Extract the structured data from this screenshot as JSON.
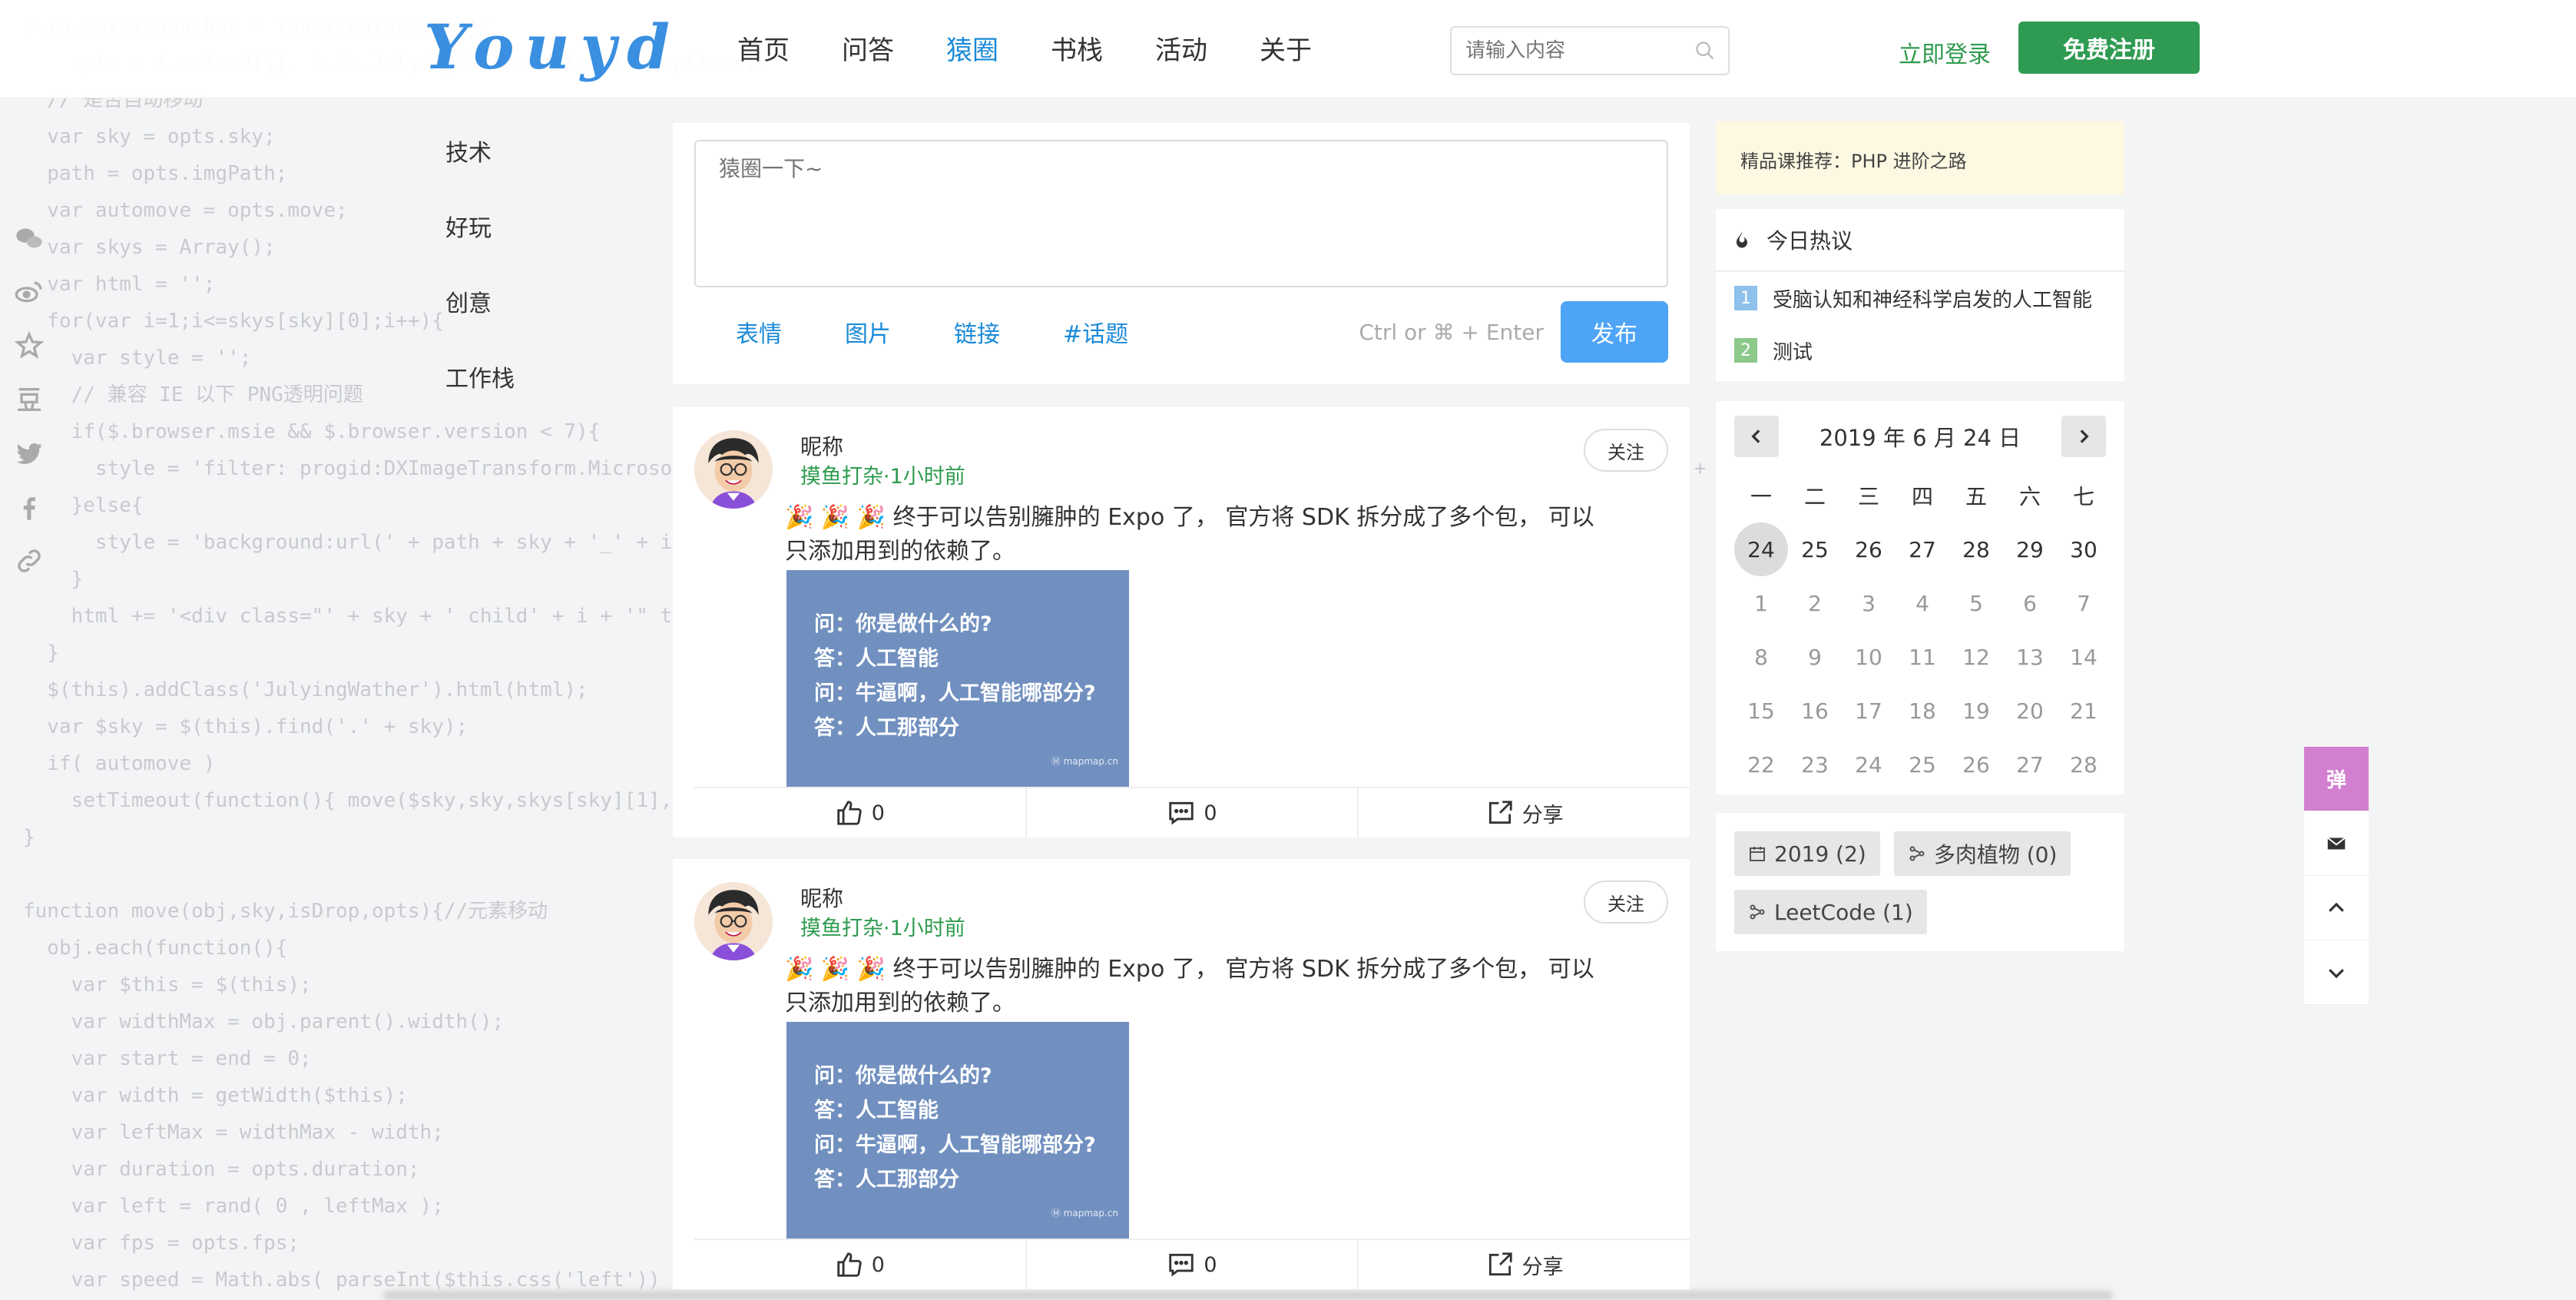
{
  "site": {
    "logo": "Youyd"
  },
  "nav": {
    "items": [
      "首页",
      "问答",
      "猿圈",
      "书栈",
      "活动",
      "关于"
    ],
    "active_index": 2
  },
  "search": {
    "placeholder": "请输入内容"
  },
  "auth": {
    "login": "立即登录",
    "register": "免费注册"
  },
  "categories": [
    "技术",
    "好玩",
    "创意",
    "工作栈"
  ],
  "social_icons": [
    "wechat-icon",
    "weibo-icon",
    "star-icon",
    "douban-icon",
    "twitter-icon",
    "facebook-icon",
    "link-icon"
  ],
  "composer": {
    "placeholder": "猿圈一下~",
    "tools": [
      "表情",
      "图片",
      "链接",
      "#话题"
    ],
    "hint": "Ctrl or ⌘ + Enter",
    "publish": "发布"
  },
  "posts": [
    {
      "name": "昵称",
      "meta": "摸鱼打杂·1小时前",
      "follow": "关注",
      "text": "🎉 🎉 🎉  终于可以告别臃肿的 Expo 了， 官方将 SDK 拆分成了多个包， 可以只添加用到的依赖了。",
      "image_lines": [
        "问：你是做什么的?",
        "答：人工智能",
        "问：牛逼啊，人工智能哪部分?",
        "答：人工那部分"
      ],
      "image_mark": "Ⓜ mapmap.cn",
      "likes": "0",
      "comments": "0",
      "share": "分享"
    },
    {
      "name": "昵称",
      "meta": "摸鱼打杂·1小时前",
      "follow": "关注",
      "text": "🎉 🎉 🎉  终于可以告别臃肿的 Expo 了， 官方将 SDK 拆分成了多个包， 可以只添加用到的依赖了。",
      "image_lines": [
        "问：你是做什么的?",
        "答：人工智能",
        "问：牛逼啊，人工智能哪部分?",
        "答：人工那部分"
      ],
      "image_mark": "Ⓜ mapmap.cn",
      "likes": "0",
      "comments": "0",
      "share": "分享"
    }
  ],
  "promo": "精品课推荐：PHP 进阶之路",
  "hot": {
    "title": "今日热议",
    "items": [
      {
        "num": "1",
        "text": "受脑认知和神经科学启发的人工智能",
        "color": "#8ec1ec"
      },
      {
        "num": "2",
        "text": "测试",
        "color": "#8cc98a"
      }
    ]
  },
  "calendar": {
    "title": "2019 年  6 月  24 日",
    "weekdays": [
      "一",
      "二",
      "三",
      "四",
      "五",
      "六",
      "七"
    ],
    "rows": [
      [
        "24",
        "25",
        "26",
        "27",
        "28",
        "29",
        "30"
      ],
      [
        "1",
        "2",
        "3",
        "4",
        "5",
        "6",
        "7"
      ],
      [
        "8",
        "9",
        "10",
        "11",
        "12",
        "13",
        "14"
      ],
      [
        "15",
        "16",
        "17",
        "18",
        "19",
        "20",
        "21"
      ],
      [
        "22",
        "23",
        "24",
        "25",
        "26",
        "27",
        "28"
      ]
    ],
    "today": "24"
  },
  "tags": [
    {
      "label": "2019 (2)",
      "icon": "calendar-icon"
    },
    {
      "label": "多肉植物 (0)",
      "icon": "branch-icon"
    },
    {
      "label": "LeetCode (1)",
      "icon": "branch-icon"
    }
  ],
  "float_tools": {
    "danmu": "弹"
  },
  "colors": {
    "accent_blue": "#1a8ad8",
    "brand_green": "#2f9b52",
    "publish_blue": "#4ea4f7"
  }
}
